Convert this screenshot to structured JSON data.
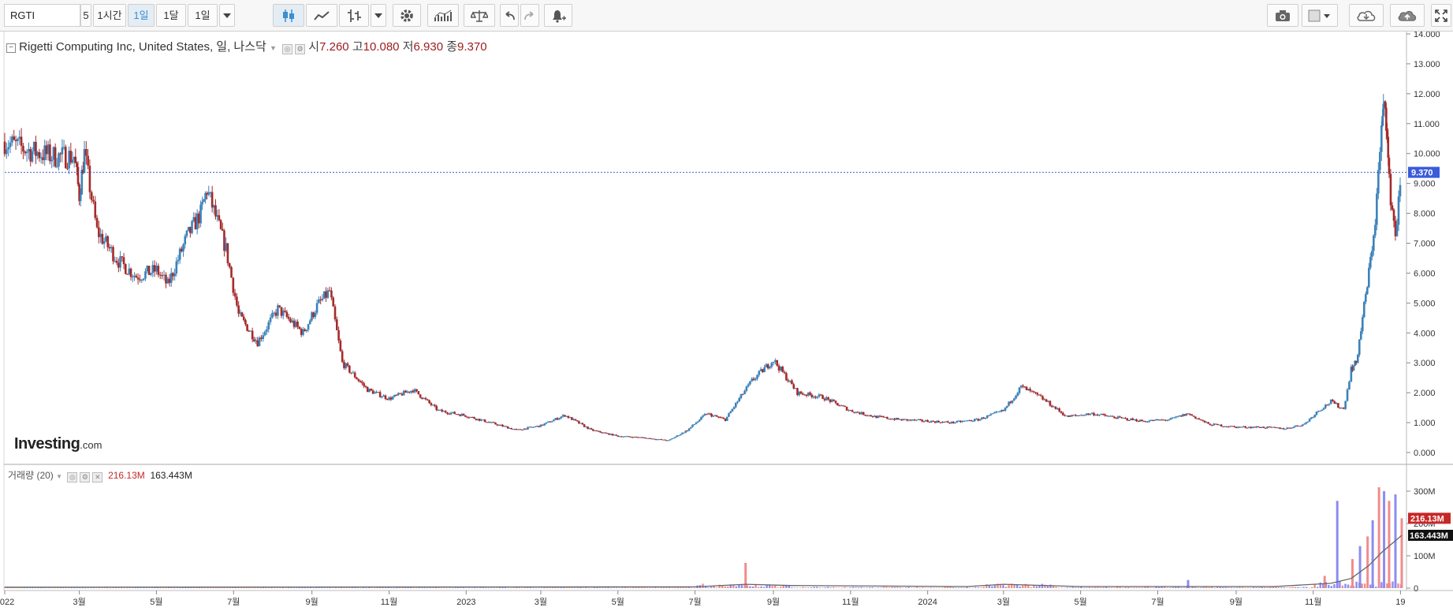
{
  "toolbar": {
    "symbol": "RGTI",
    "intervals": [
      "5",
      "1시간",
      "1일",
      "1달",
      "1일"
    ],
    "active_interval_index": 2
  },
  "legend": {
    "title": "Rigetti Computing Inc, United States, 일, 나스닥",
    "open_label": "시",
    "open_value": "7.260",
    "high_label": "고",
    "high_value": "10.080",
    "low_label": "저",
    "low_value": "6.930",
    "close_label": "종",
    "close_value": "9.370"
  },
  "volume_legend": {
    "title": "거래량 (20)",
    "volume_value": "216.13M",
    "ma_value": "163.443M"
  },
  "logo": {
    "main": "Investing",
    "suffix": ".com"
  },
  "colors": {
    "up": "#3c82b8",
    "down": "#a52a2a",
    "volume_up": "#8c8cf0",
    "volume_down": "#f08c8c",
    "current_line": "#3b5bdb",
    "ma_line": "#666666"
  },
  "chart_data": [
    {
      "type": "candlestick",
      "title": "Rigetti Computing Inc, United States, 일, 나스닥",
      "x_tick_labels": [
        "2022",
        "3월",
        "5월",
        "7월",
        "9월",
        "11월",
        "2023",
        "3월",
        "5월",
        "7월",
        "9월",
        "11월",
        "2024",
        "3월",
        "5월",
        "7월",
        "9월",
        "11월",
        "19"
      ],
      "y_ticks": [
        "0.000",
        "1.000",
        "2.000",
        "3.000",
        "4.000",
        "5.000",
        "6.000",
        "7.000",
        "8.000",
        "9.000",
        "10.000",
        "11.000",
        "12.000",
        "13.000",
        "14.000"
      ],
      "ylim": [
        0,
        14
      ],
      "current_price": 9.37,
      "current_price_label": "9.370",
      "grid": false,
      "close_series": {
        "x": [
          "2022-01",
          "2022-01-20",
          "2022-02-10",
          "2022-02-25",
          "2022-03-01",
          "2022-03-05",
          "2022-03-15",
          "2022-04-01",
          "2022-04-15",
          "2022-05-01",
          "2022-05-10",
          "2022-05-25",
          "2022-06-05",
          "2022-06-10",
          "2022-06-25",
          "2022-07-05",
          "2022-07-20",
          "2022-08-05",
          "2022-08-25",
          "2022-09-05",
          "2022-09-15",
          "2022-09-25",
          "2022-10-15",
          "2022-11-01",
          "2022-11-20",
          "2022-12-10",
          "2022-12-30",
          "2023-01-20",
          "2023-02-10",
          "2023-03-01",
          "2023-03-20",
          "2023-04-10",
          "2023-05-01",
          "2023-05-20",
          "2023-06-10",
          "2023-06-25",
          "2023-07-10",
          "2023-07-25",
          "2023-08-05",
          "2023-08-15",
          "2023-09-01",
          "2023-09-20",
          "2023-10-10",
          "2023-11-01",
          "2023-11-20",
          "2023-12-10",
          "2024-01-01",
          "2024-01-20",
          "2024-02-10",
          "2024-03-01",
          "2024-03-15",
          "2024-04-01",
          "2024-04-20",
          "2024-05-10",
          "2024-06-01",
          "2024-06-20",
          "2024-07-10",
          "2024-07-25",
          "2024-08-10",
          "2024-09-01",
          "2024-09-20",
          "2024-10-10",
          "2024-10-25",
          "2024-11-05",
          "2024-11-15",
          "2024-11-25",
          "2024-12-01",
          "2024-12-05",
          "2024-12-10",
          "2024-12-15",
          "2024-12-20",
          "2024-12-25",
          "2024-12-28",
          "2024-12-31",
          "2025-01-05",
          "2025-01-10"
        ],
        "close": [
          10.4,
          10.1,
          9.9,
          9.9,
          8.6,
          10.0,
          7.4,
          6.4,
          5.9,
          6.1,
          5.6,
          7.2,
          8.0,
          8.8,
          6.8,
          4.6,
          3.7,
          4.8,
          4.0,
          4.9,
          5.4,
          3.0,
          2.1,
          1.8,
          2.1,
          1.4,
          1.25,
          1.0,
          0.75,
          0.9,
          1.25,
          0.75,
          0.55,
          0.5,
          0.4,
          0.75,
          1.3,
          1.1,
          1.8,
          2.4,
          3.1,
          2.0,
          1.85,
          1.4,
          1.2,
          1.1,
          1.05,
          1.0,
          1.1,
          1.4,
          2.2,
          1.8,
          1.2,
          1.3,
          1.15,
          1.05,
          1.1,
          1.3,
          0.95,
          0.85,
          0.85,
          0.8,
          0.95,
          1.4,
          1.7,
          1.45,
          2.8,
          3.0,
          4.5,
          6.0,
          7.8,
          10.8,
          11.9,
          9.0,
          7.3,
          9.37
        ]
      }
    },
    {
      "type": "bar",
      "title": "거래량 (20)",
      "y_ticks": [
        "0",
        "100M",
        "200M",
        "300M"
      ],
      "ylim": [
        0,
        300
      ],
      "unit": "M",
      "current_volume_label": "216.13M",
      "current_ma_label": "163.443M",
      "ma_series": {
        "x": [
          "2022-01",
          "2023-07",
          "2023-08-10",
          "2023-09-15",
          "2024-02",
          "2024-03",
          "2024-05",
          "2024-10",
          "2024-11-15",
          "2024-12-01",
          "2024-12-15",
          "2024-12-25",
          "2025-01-10"
        ],
        "values": [
          3,
          4,
          12,
          8,
          5,
          12,
          5,
          5,
          15,
          30,
          70,
          110,
          163.443
        ]
      },
      "spikes": {
        "x": [
          "2023-08-10",
          "2024-07-25",
          "2024-11-10",
          "2024-11-20",
          "2024-12-02",
          "2024-12-08",
          "2024-12-14",
          "2024-12-18",
          "2024-12-23",
          "2024-12-27",
          "2024-12-31",
          "2025-01-05",
          "2025-01-10"
        ],
        "values": [
          78,
          25,
          38,
          270,
          90,
          130,
          160,
          210,
          320,
          300,
          270,
          290,
          216.13
        ]
      }
    }
  ]
}
